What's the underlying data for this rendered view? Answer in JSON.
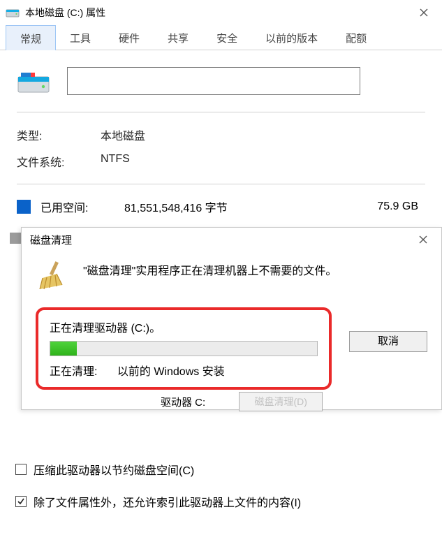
{
  "window": {
    "title": "本地磁盘 (C:) 属性"
  },
  "tabs": [
    "常规",
    "工具",
    "硬件",
    "共享",
    "安全",
    "以前的版本",
    "配额"
  ],
  "active_tab_index": 0,
  "drive_name": "",
  "type_row": {
    "label": "类型:",
    "value": "本地磁盘"
  },
  "fs_row": {
    "label": "文件系统:",
    "value": "NTFS"
  },
  "used_row": {
    "label": "已用空间:",
    "bytes": "81,551,548,416 字节",
    "gb": "75.9 GB"
  },
  "cleanup_dialog": {
    "title": "磁盘清理",
    "message": "\"磁盘清理\"实用程序正在清理机器上不需要的文件。",
    "cleaning_line": "正在清理驱动器  (C:)。",
    "progress_percent": 10,
    "status_label": "正在清理:",
    "status_value": "以前的 Windows 安装",
    "cancel_label": "取消"
  },
  "below": {
    "drive_label": "驱动器 C:",
    "disk_cleanup_btn": "磁盘清理(D)"
  },
  "checks": {
    "compress": {
      "checked": false,
      "label": "压缩此驱动器以节约磁盘空间(C)"
    },
    "index": {
      "checked": true,
      "label": "除了文件属性外，还允许索引此驱动器上文件的内容(I)"
    }
  },
  "colors": {
    "accent": "#0a62c9",
    "highlight_border": "#ea2a2a"
  }
}
